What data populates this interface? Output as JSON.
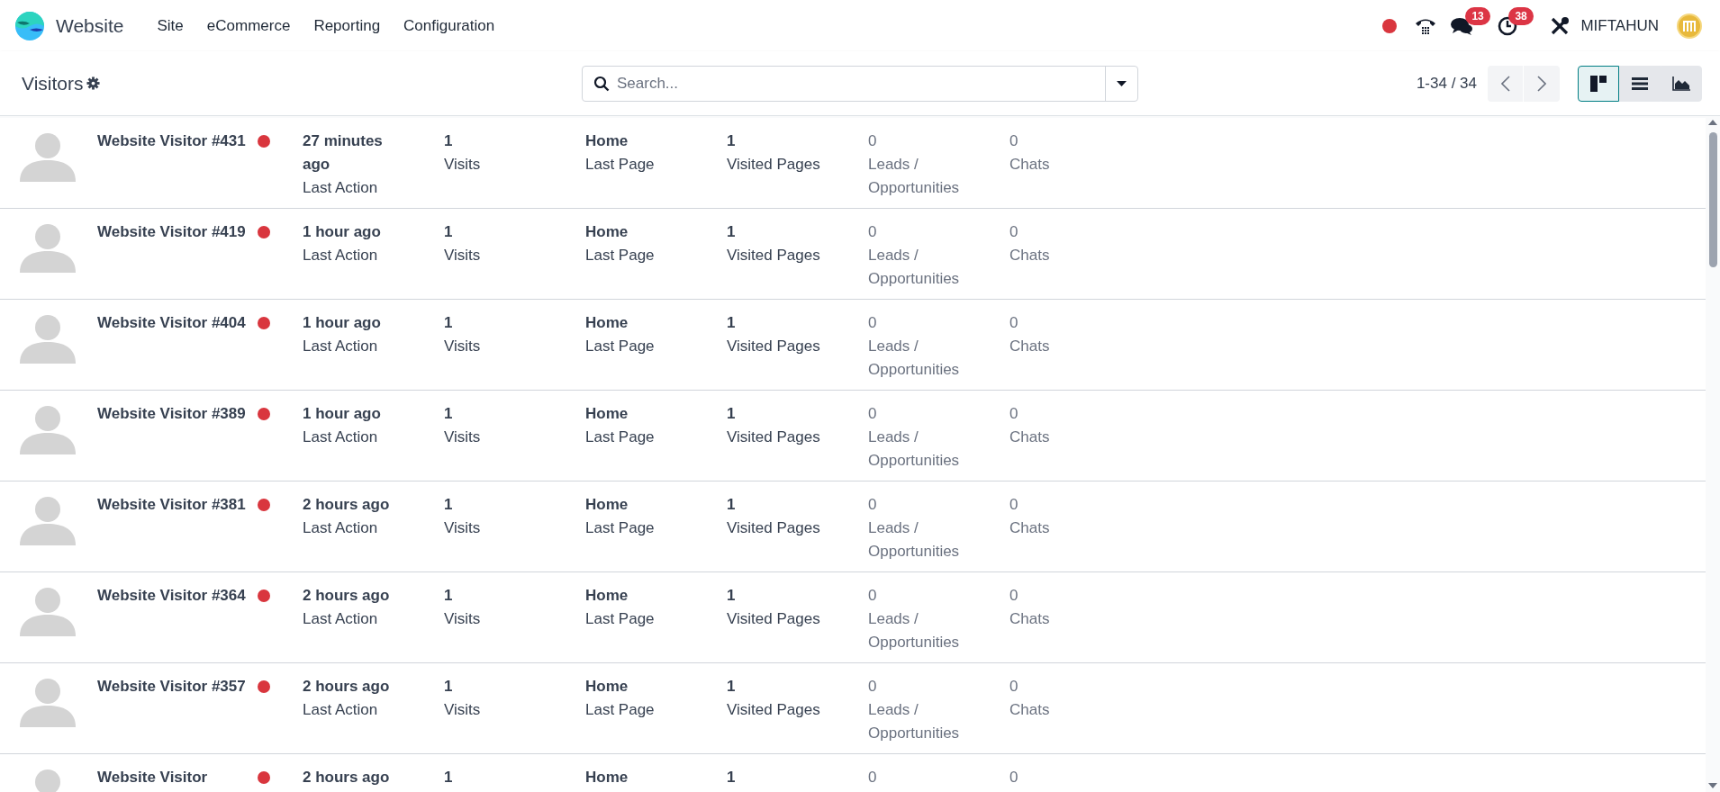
{
  "navbar": {
    "app_name": "Website",
    "menu": [
      "Site",
      "eCommerce",
      "Reporting",
      "Configuration"
    ],
    "messages_badge": "13",
    "activities_badge": "38",
    "user_name": "MIFTAHUN"
  },
  "control_panel": {
    "title": "Visitors",
    "search": {
      "placeholder": "Search..."
    },
    "pager": "1-34 / 34",
    "views": [
      {
        "kind": "kanban",
        "selected": true
      },
      {
        "kind": "list",
        "selected": false
      },
      {
        "kind": "graph",
        "selected": false
      }
    ]
  },
  "visitors": [
    {
      "name": "Website Visitor #431",
      "online": true,
      "last_action": "27 minutes ago",
      "last_action_label": "Last Action",
      "visits": "1",
      "visits_label": "Visits",
      "last_page": "Home",
      "last_page_label": "Last Page",
      "visited_pages": "1",
      "visited_pages_label": "Visited Pages",
      "leads": "0",
      "leads_label": "Leads / Opportunities",
      "chats": "0",
      "chats_label": "Chats"
    },
    {
      "name": "Website Visitor #419",
      "online": true,
      "last_action": "1 hour ago",
      "last_action_label": "Last Action",
      "visits": "1",
      "visits_label": "Visits",
      "last_page": "Home",
      "last_page_label": "Last Page",
      "visited_pages": "1",
      "visited_pages_label": "Visited Pages",
      "leads": "0",
      "leads_label": "Leads / Opportunities",
      "chats": "0",
      "chats_label": "Chats"
    },
    {
      "name": "Website Visitor #404",
      "online": true,
      "last_action": "1 hour ago",
      "last_action_label": "Last Action",
      "visits": "1",
      "visits_label": "Visits",
      "last_page": "Home",
      "last_page_label": "Last Page",
      "visited_pages": "1",
      "visited_pages_label": "Visited Pages",
      "leads": "0",
      "leads_label": "Leads / Opportunities",
      "chats": "0",
      "chats_label": "Chats"
    },
    {
      "name": "Website Visitor #389",
      "online": true,
      "last_action": "1 hour ago",
      "last_action_label": "Last Action",
      "visits": "1",
      "visits_label": "Visits",
      "last_page": "Home",
      "last_page_label": "Last Page",
      "visited_pages": "1",
      "visited_pages_label": "Visited Pages",
      "leads": "0",
      "leads_label": "Leads / Opportunities",
      "chats": "0",
      "chats_label": "Chats"
    },
    {
      "name": "Website Visitor #381",
      "online": true,
      "last_action": "2 hours ago",
      "last_action_label": "Last Action",
      "visits": "1",
      "visits_label": "Visits",
      "last_page": "Home",
      "last_page_label": "Last Page",
      "visited_pages": "1",
      "visited_pages_label": "Visited Pages",
      "leads": "0",
      "leads_label": "Leads / Opportunities",
      "chats": "0",
      "chats_label": "Chats"
    },
    {
      "name": "Website Visitor #364",
      "online": true,
      "last_action": "2 hours ago",
      "last_action_label": "Last Action",
      "visits": "1",
      "visits_label": "Visits",
      "last_page": "Home",
      "last_page_label": "Last Page",
      "visited_pages": "1",
      "visited_pages_label": "Visited Pages",
      "leads": "0",
      "leads_label": "Leads / Opportunities",
      "chats": "0",
      "chats_label": "Chats"
    },
    {
      "name": "Website Visitor #357",
      "online": true,
      "last_action": "2 hours ago",
      "last_action_label": "Last Action",
      "visits": "1",
      "visits_label": "Visits",
      "last_page": "Home",
      "last_page_label": "Last Page",
      "visited_pages": "1",
      "visited_pages_label": "Visited Pages",
      "leads": "0",
      "leads_label": "Leads / Opportunities",
      "chats": "0",
      "chats_label": "Chats"
    },
    {
      "name": "Website Visitor",
      "online": true,
      "last_action": "2 hours ago",
      "visits": "1",
      "last_page": "Home",
      "visited_pages": "1",
      "leads": "0",
      "chats": "0"
    }
  ]
}
